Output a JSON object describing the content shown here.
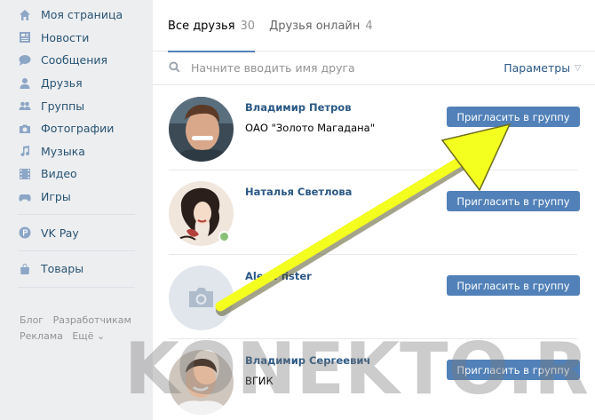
{
  "sidebar": {
    "items": [
      {
        "label": "Моя страница",
        "icon": "home-icon"
      },
      {
        "label": "Новости",
        "icon": "news-icon"
      },
      {
        "label": "Сообщения",
        "icon": "messages-icon"
      },
      {
        "label": "Друзья",
        "icon": "friends-icon"
      },
      {
        "label": "Группы",
        "icon": "groups-icon"
      },
      {
        "label": "Фотографии",
        "icon": "camera-icon"
      },
      {
        "label": "Музыка",
        "icon": "music-icon"
      },
      {
        "label": "Видео",
        "icon": "video-icon"
      },
      {
        "label": "Игры",
        "icon": "gamepad-icon"
      }
    ],
    "vkpay": {
      "label": "VK Pay",
      "icon": "vkpay-icon"
    },
    "goods": {
      "label": "Товары",
      "icon": "bag-icon"
    },
    "footer": {
      "blog": "Блог",
      "dev": "Разработчикам",
      "ads": "Реклама",
      "more": "Ещё ⌄"
    }
  },
  "tabs": [
    {
      "label": "Все друзья",
      "count": "30",
      "active": true
    },
    {
      "label": "Друзья онлайн",
      "count": "4",
      "active": false
    }
  ],
  "search": {
    "placeholder": "Начните вводить имя друга",
    "value": "",
    "params_label": "Параметры"
  },
  "friends": [
    {
      "name": "Владимир Петров",
      "subtitle": "ОАО \"Золото Магадана\"",
      "online": false
    },
    {
      "name": "Наталья Светлова",
      "subtitle": "",
      "online": true
    },
    {
      "name": "Alex Pfister",
      "subtitle": "",
      "online": false
    },
    {
      "name": "Владимир Сергеевич",
      "subtitle": "ВГИК",
      "online": false
    }
  ],
  "invite_label": "Пригласить в группу",
  "annotation": {
    "arrow_color": "#f4ff1f"
  },
  "watermark": "KONEKTO.RU",
  "colors": {
    "accent": "#5181b8",
    "link": "#2a5885",
    "sidebar_link": "#285473",
    "background": "#edeef0",
    "online": "#8ac176"
  }
}
